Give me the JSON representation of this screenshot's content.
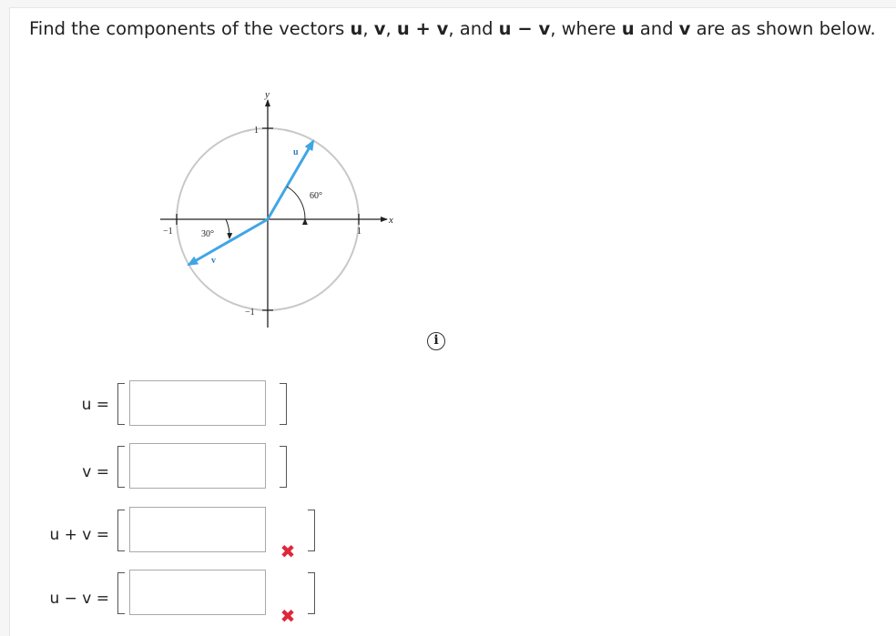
{
  "question": {
    "p1": "Find the components of the vectors ",
    "u": "u",
    "c1": ", ",
    "v": "v",
    "c2": ", ",
    "upv": "u + v",
    "c3": ", and ",
    "umv": "u − v",
    "p2": ", where ",
    "u2": "u",
    "and": " and ",
    "v2": "v",
    "p3": " are as shown below."
  },
  "figure": {
    "y_axis_label": "y",
    "x_axis_label": "x",
    "tick_top": "1",
    "tick_bottom": "−1",
    "tick_left": "−1",
    "tick_right": "1",
    "vector_u_label": "u",
    "vector_v_label": "v",
    "angle_u": "60°",
    "angle_v": "30°",
    "vector_color": "#3fa6e6",
    "circle_color": "#c8c8c8"
  },
  "info_icon": "i",
  "answers": [
    {
      "label": "u =",
      "value": "",
      "status": "unanswered"
    },
    {
      "label": "v =",
      "value": "",
      "status": "unanswered"
    },
    {
      "label": "u + v =",
      "value": "",
      "status": "incorrect"
    },
    {
      "label": "u − v =",
      "value": "",
      "status": "incorrect"
    }
  ],
  "incorrect_mark": "✖"
}
